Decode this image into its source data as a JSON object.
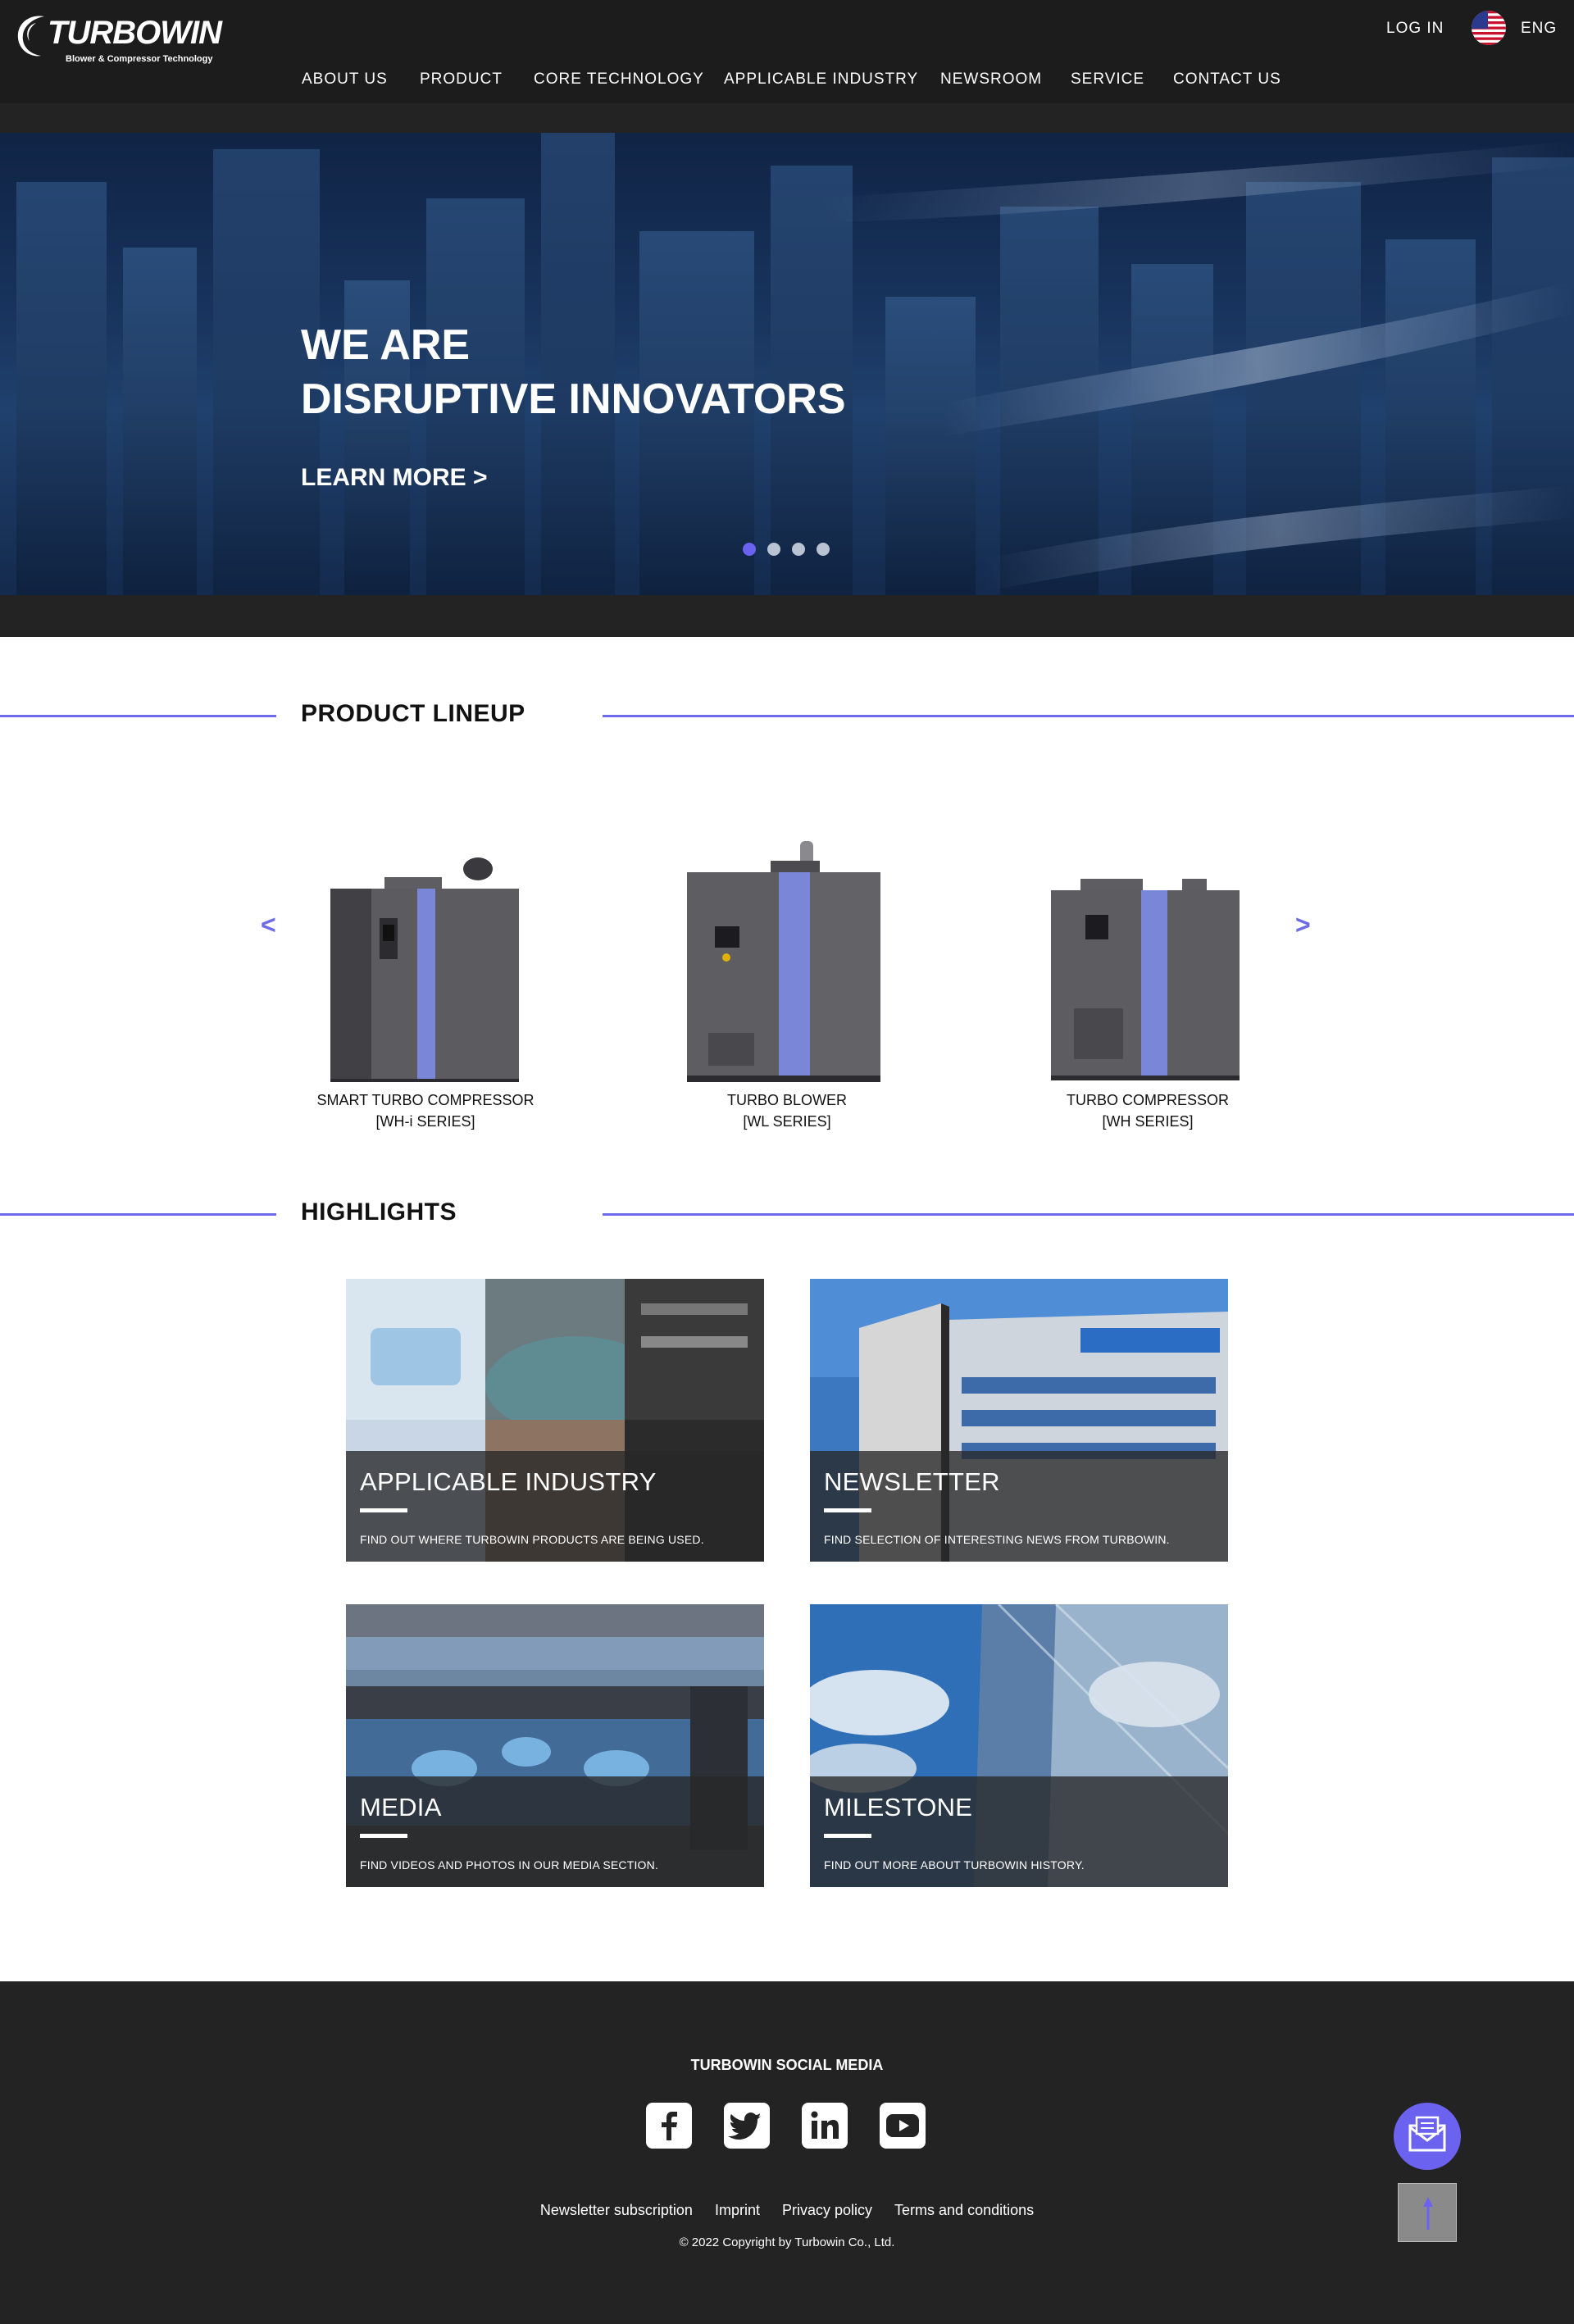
{
  "header": {
    "logo_name": "TURBOWIN",
    "logo_sub": "Blower & Compressor Technology",
    "login": "LOG IN",
    "lang": "ENG",
    "nav": [
      "ABOUT US",
      "PRODUCT",
      "CORE TECHNOLOGY",
      "APPLICABLE INDUSTRY",
      "NEWSROOM",
      "SERVICE",
      "CONTACT US"
    ]
  },
  "hero": {
    "title_line1": "WE ARE",
    "title_line2": "DISRUPTIVE INNOVATORS",
    "cta": "LEARN MORE >",
    "slide_count": 4,
    "active_slide": 1
  },
  "products": {
    "heading": "PRODUCT LINEUP",
    "prev": "<",
    "next": ">",
    "items": [
      {
        "name_line1": "SMART TURBO COMPRESSOR",
        "name_line2": "[WH-i SERIES]"
      },
      {
        "name_line1": "TURBO BLOWER",
        "name_line2": "[WL SERIES]"
      },
      {
        "name_line1": "TURBO COMPRESSOR",
        "name_line2": "[WH SERIES]"
      }
    ]
  },
  "highlights": {
    "heading": "HIGHLIGHTS",
    "cards": [
      {
        "title": "APPLICABLE INDUSTRY",
        "desc": "FIND OUT WHERE TURBOWIN PRODUCTS ARE BEING USED."
      },
      {
        "title": "NEWSLETTER",
        "desc": "FIND SELECTION OF INTERESTING NEWS FROM TURBOWIN."
      },
      {
        "title": "MEDIA",
        "desc": "FIND VIDEOS AND PHOTOS IN OUR MEDIA SECTION."
      },
      {
        "title": "MILESTONE",
        "desc": "FIND OUT MORE ABOUT TURBOWIN HISTORY."
      }
    ]
  },
  "footer": {
    "social_title": "TURBOWIN SOCIAL MEDIA",
    "socials": [
      "facebook-icon",
      "twitter-icon",
      "linkedin-icon",
      "youtube-icon"
    ],
    "links": [
      "Newsletter subscription",
      "Imprint",
      "Privacy policy",
      "Terms and conditions"
    ],
    "copyright": "© 2022 Copyright by Turbowin Co., Ltd."
  },
  "colors": {
    "accent": "#6b63f0",
    "section_line": "#6d6be8",
    "header_bg": "#1c1c1c",
    "footer_bg": "#232323"
  }
}
